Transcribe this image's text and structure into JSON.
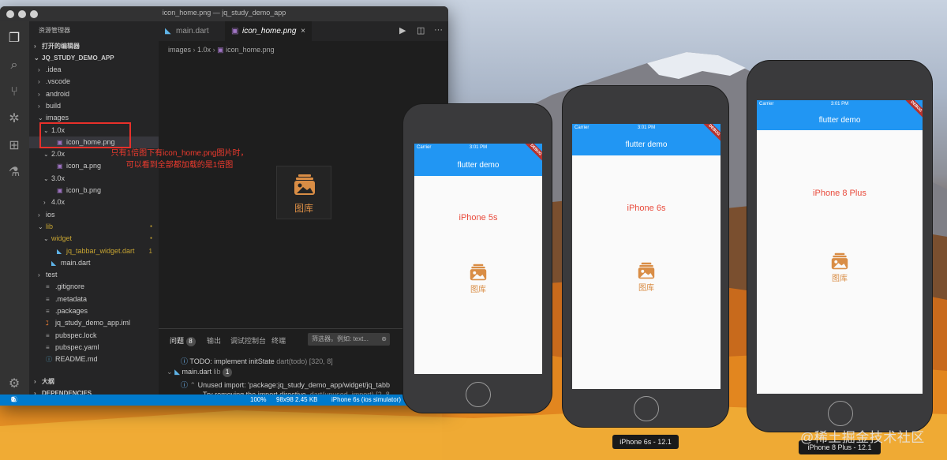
{
  "window": {
    "title": "icon_home.png — jq_study_demo_app"
  },
  "sidebar": {
    "explorer_header": "资源管理器",
    "open_editors": "打开的编辑器",
    "project": "JQ_STUDY_DEMO_APP",
    "tree": [
      {
        "label": ".idea",
        "chev": ">",
        "icon": ""
      },
      {
        "label": ".vscode",
        "chev": ">",
        "icon": ""
      },
      {
        "label": "android",
        "chev": ">",
        "icon": ""
      },
      {
        "label": "build",
        "chev": ">",
        "icon": ""
      },
      {
        "label": "images",
        "chev": "v",
        "icon": ""
      },
      {
        "label": "1.0x",
        "chev": "v",
        "icon": ""
      },
      {
        "label": "icon_home.png",
        "chev": "",
        "icon": "image"
      },
      {
        "label": "2.0x",
        "chev": "v",
        "icon": ""
      },
      {
        "label": "icon_a.png",
        "chev": "",
        "icon": "image"
      },
      {
        "label": "3.0x",
        "chev": "v",
        "icon": ""
      },
      {
        "label": "icon_b.png",
        "chev": "",
        "icon": "image"
      },
      {
        "label": "4.0x",
        "chev": ">",
        "icon": ""
      },
      {
        "label": "ios",
        "chev": ">",
        "icon": ""
      },
      {
        "label": "lib",
        "chev": "v",
        "icon": ""
      },
      {
        "label": "widget",
        "chev": "v",
        "icon": ""
      },
      {
        "label": "jq_tabbar_widget.dart",
        "chev": "",
        "icon": "dart"
      },
      {
        "label": "main.dart",
        "chev": "",
        "icon": "dart"
      },
      {
        "label": "test",
        "chev": ">",
        "icon": ""
      },
      {
        "label": ".gitignore",
        "chev": "",
        "icon": "text"
      },
      {
        "label": ".metadata",
        "chev": "",
        "icon": "text"
      },
      {
        "label": ".packages",
        "chev": "",
        "icon": "text"
      },
      {
        "label": "jq_study_demo_app.iml",
        "chev": "",
        "icon": "rss"
      },
      {
        "label": "pubspec.lock",
        "chev": "",
        "icon": "text"
      },
      {
        "label": "pubspec.yaml",
        "chev": "",
        "icon": "text"
      },
      {
        "label": "README.md",
        "chev": "",
        "icon": "info"
      }
    ],
    "widget_badge": "1",
    "outline": "大纲",
    "dependencies": "DEPENDENCIES"
  },
  "editor": {
    "tabs": [
      {
        "label": "main.dart",
        "active": false
      },
      {
        "label": "icon_home.png",
        "active": true
      }
    ],
    "breadcrumb": [
      "images",
      "1.0x",
      "icon_home.png"
    ],
    "preview_label": "图库"
  },
  "panel": {
    "tabs": [
      "问题",
      "输出",
      "调试控制台",
      "终端"
    ],
    "problem_count": "8",
    "filter_placeholder": "筛选器。例如: text...",
    "rows": [
      {
        "text": "TODO: implement initState",
        "meta": "dart(todo) [320, 8]"
      },
      {
        "text": "main.dart",
        "meta": "lib",
        "badge": "1"
      },
      {
        "text": "Unused import: 'package:jq_study_demo_app/widget/jq_tabb",
        "meta": ""
      },
      {
        "text": "Try removing the import directive.",
        "meta": "dart(unused_import) [2, 8"
      }
    ]
  },
  "statusbar": {
    "errors": "0",
    "warnings": "1",
    "infos": "7",
    "zoom": "100%",
    "size": "98x98 2.45 KB",
    "device": "iPhone 6s (ios simulator)"
  },
  "annotation": {
    "text": "只有1倍图下有icon_home.png图片时，可以看到全部都加载的是1倍图"
  },
  "phones": [
    {
      "device_label": "iPhone 5s",
      "carrier": "Carrier",
      "time": "3:01 PM",
      "title": "flutter demo",
      "debug": "DEBUG",
      "icon_label": "图库"
    },
    {
      "device_label": "iPhone 6s",
      "carrier": "Carrier",
      "time": "3:01 PM",
      "title": "flutter demo",
      "debug": "DEBUG",
      "icon_label": "图库"
    },
    {
      "device_label": "iPhone 8 Plus",
      "carrier": "Carrier",
      "time": "3:01 PM",
      "title": "flutter demo",
      "debug": "DEBUG",
      "icon_label": "图库"
    }
  ],
  "sim_labels": [
    "iPhone 6s - 12.1",
    "iPhone 8 Plus - 12.1"
  ],
  "watermark": "@稀土掘金技术社区",
  "colors": {
    "accent": "#2196f3",
    "statusbar": "#007acc",
    "annotation": "#e8302a",
    "device_label": "#e94b3c",
    "icon": "#d98d45"
  }
}
